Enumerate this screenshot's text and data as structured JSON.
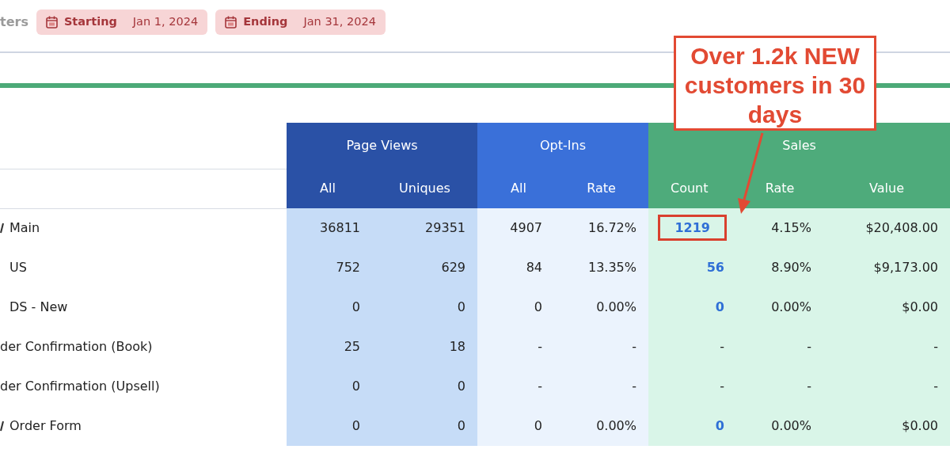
{
  "filters": {
    "label": "ters",
    "chips": [
      {
        "label": "Starting",
        "date": "Jan 1, 2024"
      },
      {
        "label": "Ending",
        "date": "Jan 31, 2024"
      }
    ]
  },
  "table": {
    "groups": [
      {
        "label": "Page Views",
        "kind": "pageviews",
        "columns": [
          "All",
          "Uniques"
        ]
      },
      {
        "label": "Opt-Ins",
        "kind": "optins",
        "columns": [
          "All",
          "Rate"
        ]
      },
      {
        "label": "Sales",
        "kind": "sales",
        "columns": [
          "Count",
          "Rate",
          "Value"
        ]
      }
    ],
    "rows": [
      {
        "name": "Main",
        "marked": true,
        "count_highlighted": true,
        "cells": [
          "36811",
          "29351",
          "4907",
          "16.72%",
          "1219",
          "4.15%",
          "$20,408.00"
        ]
      },
      {
        "name": "US",
        "marked": false,
        "count_highlighted": false,
        "cells": [
          "752",
          "629",
          "84",
          "13.35%",
          "56",
          "8.90%",
          "$9,173.00"
        ]
      },
      {
        "name": "DS - New",
        "marked": false,
        "count_highlighted": false,
        "cells": [
          "0",
          "0",
          "0",
          "0.00%",
          "0",
          "0.00%",
          "$0.00"
        ]
      },
      {
        "name": "der Confirmation (Book)",
        "marked": false,
        "count_highlighted": false,
        "cells": [
          "25",
          "18",
          "-",
          "-",
          "-",
          "-",
          "-"
        ]
      },
      {
        "name": "der Confirmation (Upsell)",
        "marked": false,
        "count_highlighted": false,
        "cells": [
          "0",
          "0",
          "-",
          "-",
          "-",
          "-",
          "-"
        ]
      },
      {
        "name": "Order Form",
        "marked": true,
        "count_highlighted": false,
        "cells": [
          "0",
          "0",
          "0",
          "0.00%",
          "0",
          "0.00%",
          "$0.00"
        ]
      }
    ]
  },
  "callout": {
    "text": "Over 1.2k NEW customers in 30 days"
  }
}
